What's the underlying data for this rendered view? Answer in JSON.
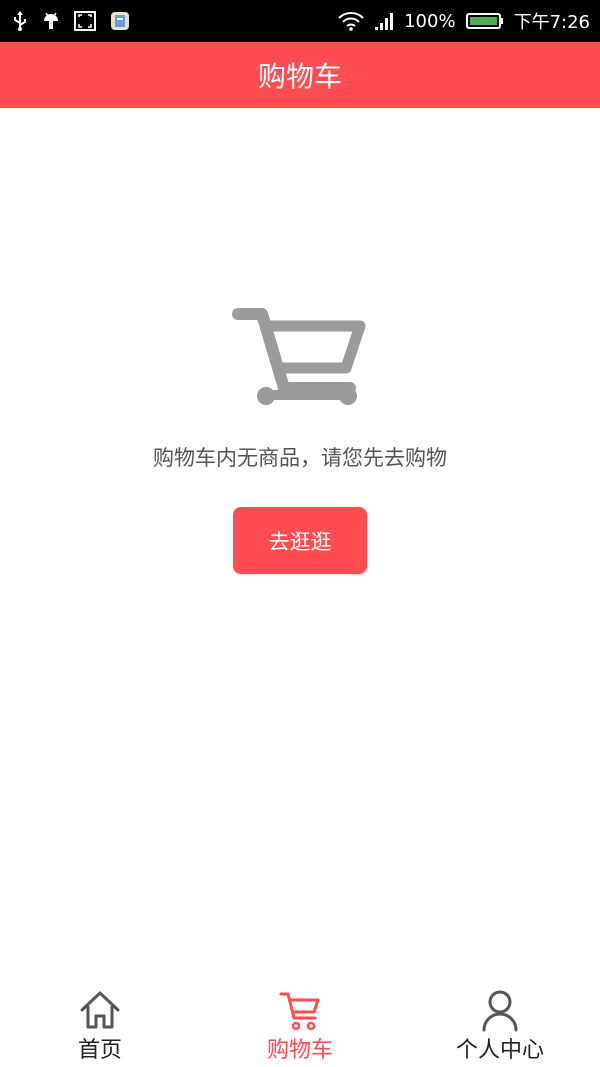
{
  "status_bar": {
    "battery": "100%",
    "time": "下午7:26"
  },
  "header": {
    "title": "购物车"
  },
  "empty_state": {
    "message": "购物车内无商品，请您先去购物",
    "button_label": "去逛逛",
    "icon": "shopping-cart-icon"
  },
  "bottom_nav": {
    "items": [
      {
        "label": "首页",
        "icon": "home-icon",
        "active": false
      },
      {
        "label": "购物车",
        "icon": "cart-icon",
        "active": true
      },
      {
        "label": "个人中心",
        "icon": "person-icon",
        "active": false
      }
    ]
  },
  "colors": {
    "accent": "#ff4d52",
    "status_bar": "#000000",
    "empty_icon": "#9b9b9b",
    "text_secondary": "#555555"
  }
}
